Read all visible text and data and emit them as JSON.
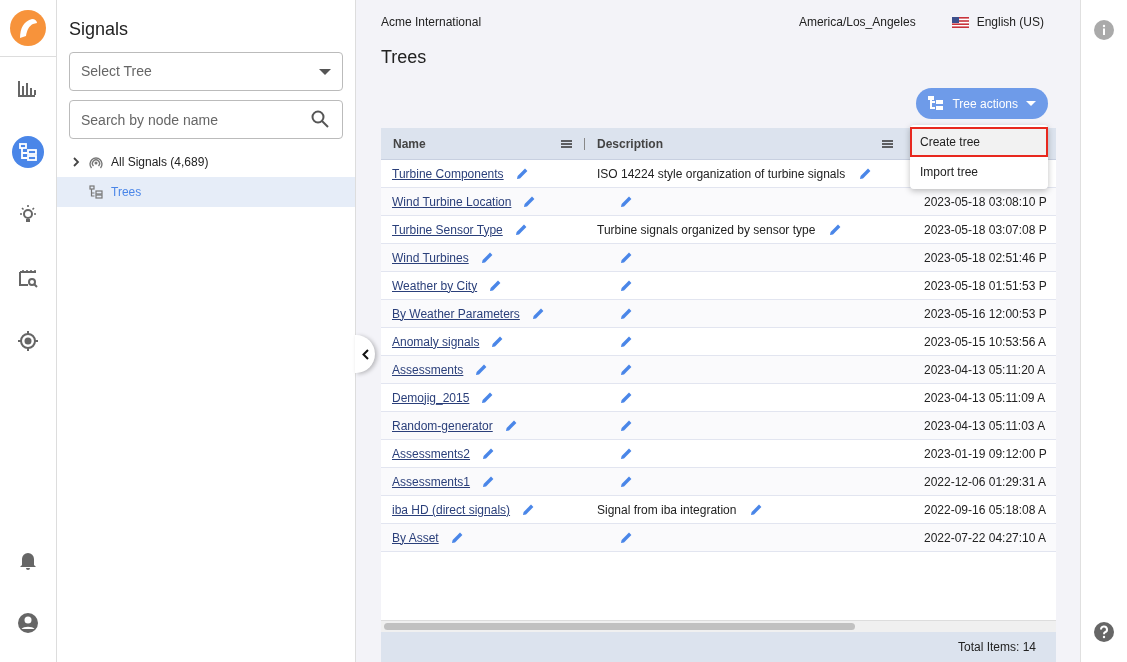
{
  "nav_rail": {
    "top_items": [
      {
        "kind": "chart",
        "selected": false
      },
      {
        "kind": "tree",
        "selected": true
      },
      {
        "kind": "bulb",
        "selected": false
      },
      {
        "kind": "clapper",
        "selected": false
      },
      {
        "kind": "target",
        "selected": false
      }
    ],
    "bottom_items": [
      {
        "kind": "bell",
        "selected": false
      },
      {
        "kind": "user",
        "selected": false
      }
    ]
  },
  "sidebar": {
    "title": "Signals",
    "select": {
      "placeholder": "Select Tree"
    },
    "search": {
      "placeholder": "Search by node name"
    },
    "tree": [
      {
        "kind": "group",
        "label": "All Signals (4,689)",
        "expanded": false,
        "selected": false
      },
      {
        "kind": "tree",
        "label": "Trees",
        "selected": true
      }
    ]
  },
  "header": {
    "organization": "Acme International",
    "timezone": "America/Los_Angeles",
    "language": "English (US)"
  },
  "page_title": "Trees",
  "actions_button": {
    "label": "Tree actions"
  },
  "actions_menu": [
    {
      "label": "Create tree",
      "highlighted": true
    },
    {
      "label": "Import tree",
      "highlighted": false
    }
  ],
  "table": {
    "columns": [
      "Name",
      "Description"
    ],
    "rows": [
      {
        "name": "Turbine Components",
        "description": "ISO 14224 style organization of turbine signals"
      },
      {
        "name": "Wind Turbine Location",
        "description": "",
        "column_3": "2023-05-18 03:08:10 P"
      },
      {
        "name": "Turbine Sensor Type",
        "description": "Turbine signals organized by sensor type",
        "column_3": "2023-05-18 03:07:08 P"
      },
      {
        "name": "Wind Turbines",
        "description": "",
        "column_3": "2023-05-18 02:51:46 P"
      },
      {
        "name": "Weather by City",
        "description": "",
        "column_3": "2023-05-18 01:51:53 P"
      },
      {
        "name": "By Weather Parameters",
        "description": "",
        "column_3": "2023-05-16 12:00:53 P"
      },
      {
        "name": "Anomaly signals",
        "description": "",
        "column_3": "2023-05-15 10:53:56 A"
      },
      {
        "name": "Assessments",
        "description": "",
        "column_3": "2023-04-13 05:11:20 A"
      },
      {
        "name": "Demojig_2015",
        "description": "",
        "column_3": "2023-04-13 05:11:09 A"
      },
      {
        "name": "Random-generator",
        "description": "",
        "column_3": "2023-04-13 05:11:03 A"
      },
      {
        "name": "Assessments2",
        "description": "",
        "column_3": "2023-01-19 09:12:00 P"
      },
      {
        "name": "Assessments1",
        "description": "",
        "column_3": "2022-12-06 01:29:31 A"
      },
      {
        "name": "iba HD (direct signals)",
        "description": "Signal from iba integration",
        "column_3": "2022-09-16 05:18:08 A"
      },
      {
        "name": "By Asset",
        "description": "",
        "column_3": "2022-07-22 04:27:10 A"
      }
    ],
    "footer": "Total Items: 14"
  }
}
